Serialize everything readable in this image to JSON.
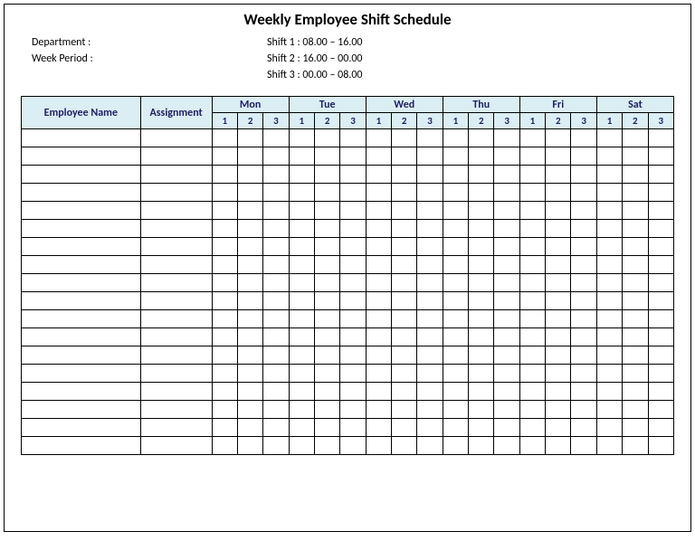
{
  "title": "Weekly Employee Shift Schedule",
  "meta": {
    "department_label": "Department    :",
    "week_period_label": "Week  Period :",
    "shift1": "Shift 1  : 08.00  – 16.00",
    "shift2": "Shift 2  : 16.00  – 00.00",
    "shift3": "Shift 3  : 00.00 – 08.00"
  },
  "headers": {
    "employee": "Employee Name",
    "assignment": "Assignment",
    "days": [
      "Mon",
      "Tue",
      "Wed",
      "Thu",
      "Fri",
      "Sat"
    ],
    "shifts": [
      "1",
      "2",
      "3"
    ]
  },
  "row_count": 18
}
